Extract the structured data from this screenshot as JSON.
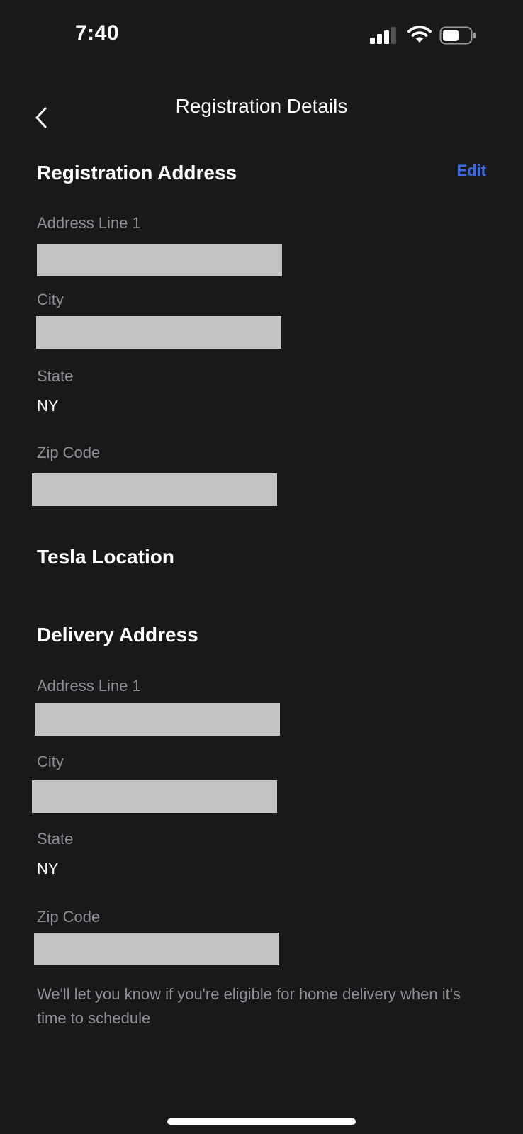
{
  "status_bar": {
    "time": "7:40",
    "icons": [
      "cellular-signal-icon",
      "wifi-icon",
      "battery-icon"
    ]
  },
  "nav": {
    "title": "Registration Details",
    "back_icon": "chevron-left-icon"
  },
  "registration_address": {
    "title": "Registration Address",
    "edit_label": "Edit",
    "fields": [
      {
        "label": "Address Line 1",
        "value": ""
      },
      {
        "label": "City",
        "value": ""
      },
      {
        "label": "State",
        "value": "NY"
      },
      {
        "label": "Zip Code",
        "value": ""
      }
    ]
  },
  "tesla_location": {
    "title": "Tesla Location"
  },
  "delivery_address": {
    "title": "Delivery Address",
    "fields": [
      {
        "label": "Address Line 1",
        "value": ""
      },
      {
        "label": "City",
        "value": ""
      },
      {
        "label": "State",
        "value": "NY"
      },
      {
        "label": "Zip Code",
        "value": ""
      }
    ],
    "note": "We'll let you know if you're eligible for home delivery when it's time to schedule"
  },
  "colors": {
    "background": "#18191b",
    "accent": "#3e6ae1",
    "label": "#8e8e93",
    "redacted": "#c3c3c3"
  }
}
